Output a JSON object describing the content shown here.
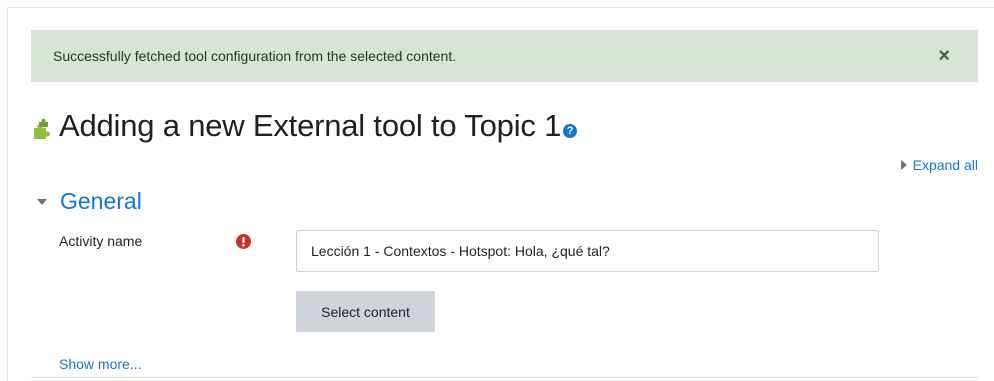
{
  "alert": {
    "message": "Successfully fetched tool configuration from the selected content.",
    "close_label": "×"
  },
  "page": {
    "title": "Adding a new External tool to Topic 1",
    "help_label": "?"
  },
  "actions": {
    "expand_all": "Expand all"
  },
  "section": {
    "title": "General",
    "activity_name_label": "Activity name",
    "activity_name_value": "Lección 1 - Contextos - Hotspot: Hola, ¿qué tal?",
    "select_content_button": "Select content",
    "show_more": "Show more..."
  },
  "colors": {
    "alert_bg": "#d7e6d4",
    "link": "#1177d1",
    "required": "#ca3120",
    "button_bg": "#ced4da"
  },
  "icons": [
    "puzzle-icon",
    "help-icon",
    "expand-arrow-icon",
    "collapse-caret-icon",
    "required-icon"
  ]
}
